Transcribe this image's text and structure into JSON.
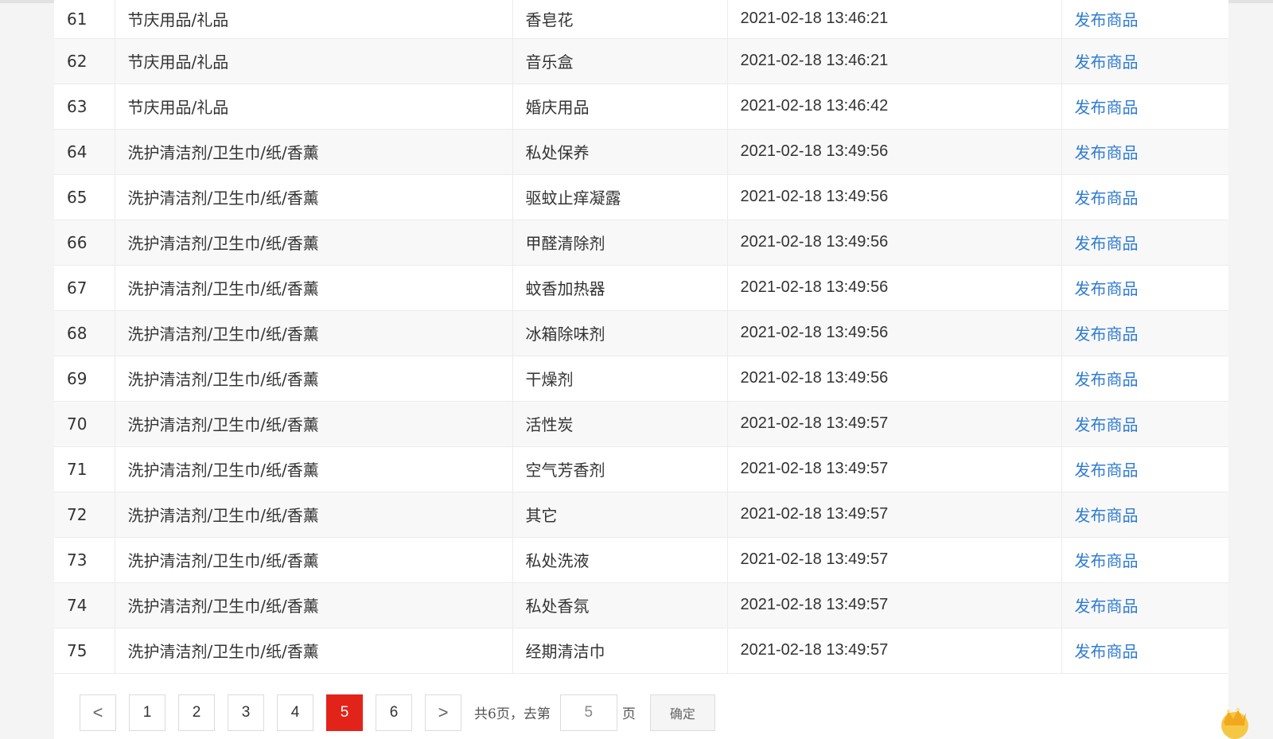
{
  "rows": [
    {
      "no": "61",
      "category": "节庆用品/礼品",
      "subcategory": "香皂花",
      "time": "2021-02-18 13:46:21",
      "action": "发布商品"
    },
    {
      "no": "62",
      "category": "节庆用品/礼品",
      "subcategory": "音乐盒",
      "time": "2021-02-18 13:46:21",
      "action": "发布商品"
    },
    {
      "no": "63",
      "category": "节庆用品/礼品",
      "subcategory": "婚庆用品",
      "time": "2021-02-18 13:46:42",
      "action": "发布商品"
    },
    {
      "no": "64",
      "category": "洗护清洁剂/卫生巾/纸/香薰",
      "subcategory": "私处保养",
      "time": "2021-02-18 13:49:56",
      "action": "发布商品"
    },
    {
      "no": "65",
      "category": "洗护清洁剂/卫生巾/纸/香薰",
      "subcategory": "驱蚊止痒凝露",
      "time": "2021-02-18 13:49:56",
      "action": "发布商品"
    },
    {
      "no": "66",
      "category": "洗护清洁剂/卫生巾/纸/香薰",
      "subcategory": "甲醛清除剂",
      "time": "2021-02-18 13:49:56",
      "action": "发布商品"
    },
    {
      "no": "67",
      "category": "洗护清洁剂/卫生巾/纸/香薰",
      "subcategory": "蚊香加热器",
      "time": "2021-02-18 13:49:56",
      "action": "发布商品"
    },
    {
      "no": "68",
      "category": "洗护清洁剂/卫生巾/纸/香薰",
      "subcategory": "冰箱除味剂",
      "time": "2021-02-18 13:49:56",
      "action": "发布商品"
    },
    {
      "no": "69",
      "category": "洗护清洁剂/卫生巾/纸/香薰",
      "subcategory": "干燥剂",
      "time": "2021-02-18 13:49:56",
      "action": "发布商品"
    },
    {
      "no": "70",
      "category": "洗护清洁剂/卫生巾/纸/香薰",
      "subcategory": "活性炭",
      "time": "2021-02-18 13:49:57",
      "action": "发布商品"
    },
    {
      "no": "71",
      "category": "洗护清洁剂/卫生巾/纸/香薰",
      "subcategory": "空气芳香剂",
      "time": "2021-02-18 13:49:57",
      "action": "发布商品"
    },
    {
      "no": "72",
      "category": "洗护清洁剂/卫生巾/纸/香薰",
      "subcategory": "其它",
      "time": "2021-02-18 13:49:57",
      "action": "发布商品"
    },
    {
      "no": "73",
      "category": "洗护清洁剂/卫生巾/纸/香薰",
      "subcategory": "私处洗液",
      "time": "2021-02-18 13:49:57",
      "action": "发布商品"
    },
    {
      "no": "74",
      "category": "洗护清洁剂/卫生巾/纸/香薰",
      "subcategory": "私处香氛",
      "time": "2021-02-18 13:49:57",
      "action": "发布商品"
    },
    {
      "no": "75",
      "category": "洗护清洁剂/卫生巾/纸/香薰",
      "subcategory": "经期清洁巾",
      "time": "2021-02-18 13:49:57",
      "action": "发布商品"
    }
  ],
  "pagination": {
    "prev_icon": "chevron-left-icon",
    "next_icon": "chevron-right-icon",
    "prev_glyph": "<",
    "next_glyph": ">",
    "pages": [
      "1",
      "2",
      "3",
      "4",
      "5",
      "6"
    ],
    "current_page": "5",
    "total_text": "共6页，去第",
    "goto_value": "5",
    "page_suffix": "页",
    "confirm_label": "确定"
  },
  "colors": {
    "link": "#2e7bd2",
    "active_page": "#e2231a",
    "row_stripe": "#f8f8f8"
  }
}
